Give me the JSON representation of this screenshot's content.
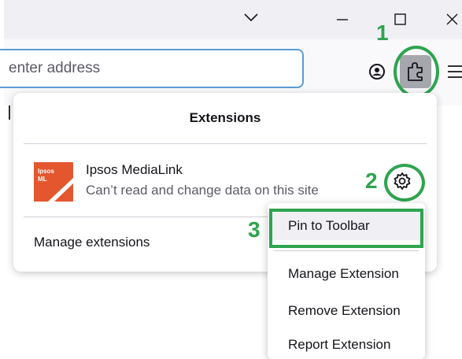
{
  "address_bar": {
    "placeholder": "enter address"
  },
  "panel": {
    "title": "Extensions",
    "extension": {
      "name": "Ipsos MediaLink",
      "description": "Can’t read and change data on this site",
      "logo_text_line1": "Ipsos",
      "logo_text_line2": "ML"
    },
    "manage_label": "Manage extensions"
  },
  "context_menu": {
    "items": [
      {
        "label": "Pin to Toolbar"
      },
      {
        "label": "Manage Extension"
      },
      {
        "label": "Remove Extension"
      },
      {
        "label": "Report Extension"
      }
    ]
  },
  "annotations": [
    "1",
    "2",
    "3"
  ],
  "colors": {
    "annotation_green": "#2ea44f",
    "focus_blue": "#5b9bd5",
    "logo_orange": "#e4572e"
  },
  "icons": [
    "chevron-down-icon",
    "minimize-icon",
    "maximize-icon",
    "close-icon",
    "account-icon",
    "extensions-puzzle-icon",
    "menu-hamburger-icon",
    "gear-icon"
  ]
}
